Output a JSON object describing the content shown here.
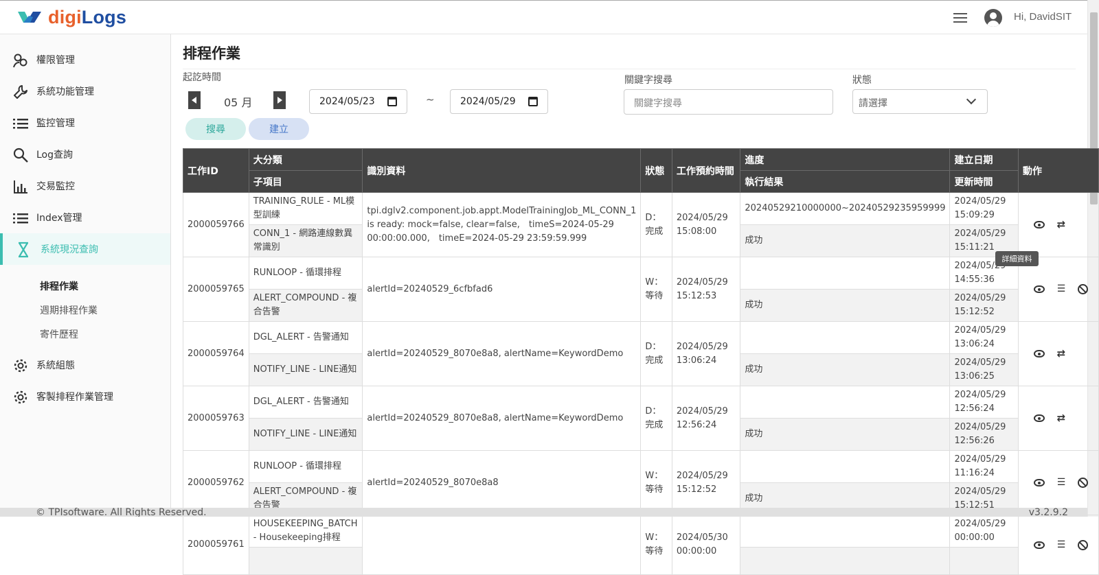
{
  "app": {
    "logo_a": "digi",
    "logo_b": "Logs",
    "greeting": "Hi, DavidSIT",
    "brand_accent": "#3bbdb0",
    "brand_orange": "#e8612c",
    "brand_blue": "#1f4ea1"
  },
  "sidebar": {
    "items": [
      {
        "label": "權限管理",
        "icon": "user-group-icon"
      },
      {
        "label": "系統功能管理",
        "icon": "wrench-icon"
      },
      {
        "label": "監控管理",
        "icon": "list-icon"
      },
      {
        "label": "Log查詢",
        "icon": "search-icon"
      },
      {
        "label": "交易監控",
        "icon": "bar-chart-icon"
      },
      {
        "label": "Index管理",
        "icon": "list-icon"
      },
      {
        "label": "系統現況查詢",
        "icon": "hourglass-icon"
      },
      {
        "label": "系統組態",
        "icon": "gear-icon"
      },
      {
        "label": "客製排程作業管理",
        "icon": "gear-icon"
      }
    ],
    "sub_items": [
      {
        "label": "排程作業"
      },
      {
        "label": "週期排程作業"
      },
      {
        "label": "寄件歷程"
      }
    ]
  },
  "page": {
    "title": "排程作業"
  },
  "filters": {
    "time_label": "起訖時間",
    "month": "05 月",
    "date_from": "2024/05/23",
    "tilde": "~",
    "date_to": "2024/05/29",
    "keyword_label": "關鍵字搜尋",
    "keyword_placeholder": "關鍵字搜尋",
    "status_label": "狀態",
    "status_placeholder": "請選擇",
    "search_button": "搜尋",
    "create_button": "建立"
  },
  "table": {
    "headers": {
      "job_id": "工作ID",
      "category": "大分類",
      "sub_item": "子項目",
      "identify": "識別資料",
      "status": "狀態",
      "scheduled": "工作預約時間",
      "progress": "進度",
      "result": "執行結果",
      "created": "建立日期",
      "updated": "更新時間",
      "actions": "動作"
    },
    "rows": [
      {
        "job_id": "2000059766",
        "category": "TRAINING_RULE - ML模型訓練",
        "sub_item": "CONN_1 - 網路連線數異常識別",
        "identify": "tpi.dglv2.component.job.appt.ModelTrainingJob_ML_CONN_1 is ready: mock=false, clear=false,　timeS=2024-05-29 00:00:00.000,　timeE=2024-05-29 23:59:59.999",
        "status": "D：完成",
        "scheduled": "2024/05/29 15:08:00",
        "progress": "20240529210000000~20240529235959999",
        "result": "成功",
        "created": "2024/05/29 15:09:29",
        "updated": "2024/05/29 15:11:21",
        "actions": [
          "eye-icon",
          "repeat-icon"
        ]
      },
      {
        "job_id": "2000059765",
        "category": "RUNLOOP - 循環排程",
        "sub_item": "ALERT_COMPOUND - 複合告警",
        "identify": "alertId=20240529_6cfbfad6",
        "status": "W：等待",
        "scheduled": "2024/05/29 15:12:53",
        "progress": "",
        "result": "成功",
        "created": "2024/05/29 14:55:36",
        "updated": "2024/05/29 15:12:52",
        "actions": [
          "eye-icon",
          "checklist-icon",
          "cancel-icon"
        ]
      },
      {
        "job_id": "2000059764",
        "category": "DGL_ALERT - 告警通知",
        "sub_item": "NOTIFY_LINE - LINE通知",
        "identify": "alertId=20240529_8070e8a8, alertName=KeywordDemo",
        "status": "D：完成",
        "scheduled": "2024/05/29 13:06:24",
        "progress": "",
        "result": "成功",
        "created": "2024/05/29 13:06:24",
        "updated": "2024/05/29 13:06:25",
        "actions": [
          "eye-icon",
          "repeat-icon"
        ]
      },
      {
        "job_id": "2000059763",
        "category": "DGL_ALERT - 告警通知",
        "sub_item": "NOTIFY_LINE - LINE通知",
        "identify": "alertId=20240529_8070e8a8, alertName=KeywordDemo",
        "status": "D：完成",
        "scheduled": "2024/05/29 12:56:24",
        "progress": "",
        "result": "成功",
        "created": "2024/05/29 12:56:24",
        "updated": "2024/05/29 12:56:26",
        "actions": [
          "eye-icon",
          "repeat-icon"
        ]
      },
      {
        "job_id": "2000059762",
        "category": "RUNLOOP - 循環排程",
        "sub_item": "ALERT_COMPOUND - 複合告警",
        "identify": "alertId=20240529_8070e8a8",
        "status": "W：等待",
        "scheduled": "2024/05/29 15:12:52",
        "progress": "",
        "result": "成功",
        "created": "2024/05/29 11:16:24",
        "updated": "2024/05/29 15:12:51",
        "actions": [
          "eye-icon",
          "checklist-icon",
          "cancel-icon"
        ]
      },
      {
        "job_id": "2000059761",
        "category": "HOUSEKEEPING_BATCH - Housekeeping排程",
        "sub_item": "",
        "identify": "",
        "status": "W：等待",
        "scheduled": "2024/05/30 00:00:00",
        "progress": "",
        "result": "",
        "created": "2024/05/29 00:00:00",
        "updated": "",
        "actions": [
          "eye-icon",
          "checklist-icon",
          "cancel-icon"
        ]
      }
    ]
  },
  "tooltip": "詳細資料",
  "footer": {
    "copyright": "© TPIsoftware. All Rights Reserved.",
    "version": "v3.2.9.2"
  }
}
